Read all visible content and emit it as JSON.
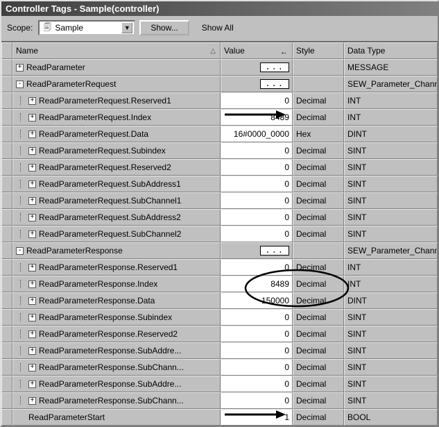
{
  "title": "Controller Tags - Sample(controller)",
  "toolbar": {
    "scope_label": "Scope:",
    "scope_value": "Sample",
    "show_btn": "Show...",
    "showall": "Show All"
  },
  "columns": {
    "name": "Name",
    "value": "Value",
    "style": "Style",
    "dtype": "Data Type"
  },
  "rows": [
    {
      "depth": 0,
      "exp": "+",
      "name": "ReadParameter",
      "value": "{...}",
      "valcell": "gray",
      "style": "",
      "dtype": "MESSAGE"
    },
    {
      "depth": 0,
      "exp": "-",
      "name": "ReadParameterRequest",
      "value": "{...}",
      "valcell": "gray",
      "style": "",
      "dtype": "SEW_Parameter_Channel"
    },
    {
      "depth": 1,
      "exp": "+",
      "name": "ReadParameterRequest.Reserved1",
      "value": "0",
      "valcell": "white",
      "style": "Decimal",
      "dtype": "INT"
    },
    {
      "depth": 1,
      "exp": "+",
      "name": "ReadParameterRequest.Index",
      "value": "8489",
      "valcell": "white",
      "style": "Decimal",
      "dtype": "INT"
    },
    {
      "depth": 1,
      "exp": "+",
      "name": "ReadParameterRequest.Data",
      "value": "16#0000_0000",
      "valcell": "white",
      "style": "Hex",
      "dtype": "DINT"
    },
    {
      "depth": 1,
      "exp": "+",
      "name": "ReadParameterRequest.Subindex",
      "value": "0",
      "valcell": "white",
      "style": "Decimal",
      "dtype": "SINT"
    },
    {
      "depth": 1,
      "exp": "+",
      "name": "ReadParameterRequest.Reserved2",
      "value": "0",
      "valcell": "white",
      "style": "Decimal",
      "dtype": "SINT"
    },
    {
      "depth": 1,
      "exp": "+",
      "name": "ReadParameterRequest.SubAddress1",
      "value": "0",
      "valcell": "white",
      "style": "Decimal",
      "dtype": "SINT"
    },
    {
      "depth": 1,
      "exp": "+",
      "name": "ReadParameterRequest.SubChannel1",
      "value": "0",
      "valcell": "white",
      "style": "Decimal",
      "dtype": "SINT"
    },
    {
      "depth": 1,
      "exp": "+",
      "name": "ReadParameterRequest.SubAddress2",
      "value": "0",
      "valcell": "white",
      "style": "Decimal",
      "dtype": "SINT"
    },
    {
      "depth": 1,
      "exp": "+",
      "name": "ReadParameterRequest.SubChannel2",
      "value": "0",
      "valcell": "white",
      "style": "Decimal",
      "dtype": "SINT"
    },
    {
      "depth": 0,
      "exp": "-",
      "name": "ReadParameterResponse",
      "value": "{...}",
      "valcell": "gray",
      "style": "",
      "dtype": "SEW_Parameter_Channel"
    },
    {
      "depth": 1,
      "exp": "+",
      "name": "ReadParameterResponse.Reserved1",
      "value": "0",
      "valcell": "white",
      "style": "Decimal",
      "dtype": "INT"
    },
    {
      "depth": 1,
      "exp": "+",
      "name": "ReadParameterResponse.Index",
      "value": "8489",
      "valcell": "white",
      "style": "Decimal",
      "dtype": "INT"
    },
    {
      "depth": 1,
      "exp": "+",
      "name": "ReadParameterResponse.Data",
      "value": "150000",
      "valcell": "white",
      "style": "Decimal",
      "dtype": "DINT"
    },
    {
      "depth": 1,
      "exp": "+",
      "name": "ReadParameterResponse.Subindex",
      "value": "0",
      "valcell": "white",
      "style": "Decimal",
      "dtype": "SINT"
    },
    {
      "depth": 1,
      "exp": "+",
      "name": "ReadParameterResponse.Reserved2",
      "value": "0",
      "valcell": "white",
      "style": "Decimal",
      "dtype": "SINT"
    },
    {
      "depth": 1,
      "exp": "+",
      "name": "ReadParameterResponse.SubAddre...",
      "value": "0",
      "valcell": "white",
      "style": "Decimal",
      "dtype": "SINT"
    },
    {
      "depth": 1,
      "exp": "+",
      "name": "ReadParameterResponse.SubChann...",
      "value": "0",
      "valcell": "white",
      "style": "Decimal",
      "dtype": "SINT"
    },
    {
      "depth": 1,
      "exp": "+",
      "name": "ReadParameterResponse.SubAddre...",
      "value": "0",
      "valcell": "white",
      "style": "Decimal",
      "dtype": "SINT"
    },
    {
      "depth": 1,
      "exp": "+",
      "name": "ReadParameterResponse.SubChann...",
      "value": "0",
      "valcell": "white",
      "style": "Decimal",
      "dtype": "SINT"
    },
    {
      "depth": 0,
      "exp": "",
      "name": "ReadParameterStart",
      "value": "1",
      "valcell": "white",
      "style": "Decimal",
      "dtype": "BOOL"
    }
  ]
}
